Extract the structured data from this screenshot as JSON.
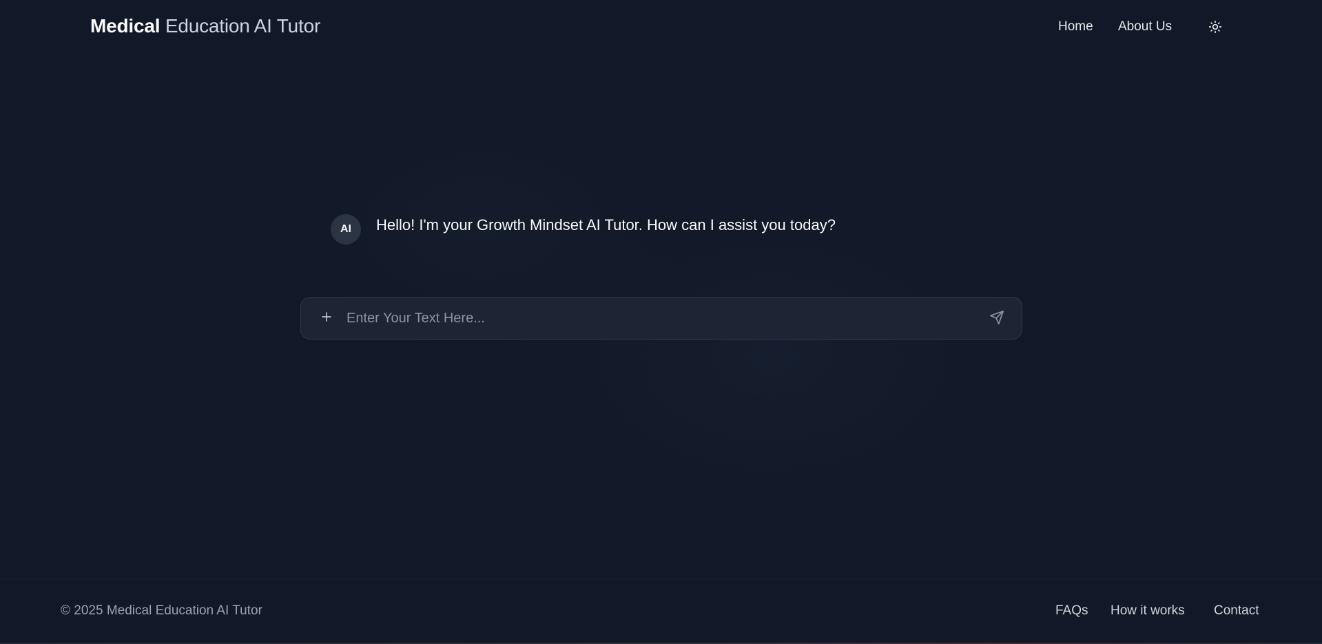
{
  "header": {
    "brand_primary": "Medical",
    "brand_secondary": "Education AI Tutor",
    "nav": [
      {
        "label": "Home"
      },
      {
        "label": "About Us"
      }
    ],
    "theme_toggle_icon": "sun-icon"
  },
  "chat": {
    "messages": [
      {
        "avatar": "AI",
        "text": "Hello! I'm your Growth Mindset AI Tutor. How can I assist you today?"
      }
    ],
    "input": {
      "placeholder": "Enter Your Text Here...",
      "value": "",
      "attach_icon": "plus-icon",
      "send_icon": "send-icon"
    }
  },
  "footer": {
    "copyright": "© 2025 Medical Education AI Tutor",
    "links": [
      {
        "label": "FAQs"
      },
      {
        "label": "How it works"
      },
      {
        "label": "Contact"
      }
    ]
  },
  "colors": {
    "background": "#111827",
    "input_background": "#1e2433",
    "avatar_background": "#2b3443",
    "text_primary": "#f9fafb",
    "text_muted": "#9ca3af"
  }
}
